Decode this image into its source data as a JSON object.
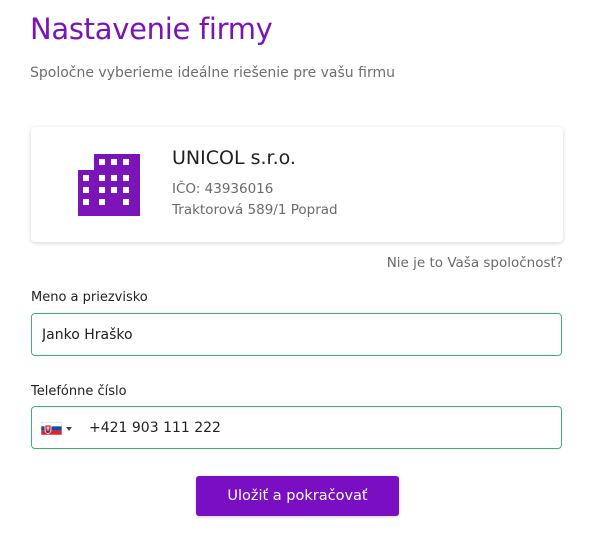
{
  "header": {
    "title": "Nastavenie firmy",
    "subtitle": "Spoločne vyberieme ideálne riešenie pre vašu firmu"
  },
  "company": {
    "icon": "building-icon",
    "name": "UNICOL s.r.o.",
    "ico": "IČO: 43936016",
    "address": "Traktorová 589/1 Poprad",
    "not_yours_link": "Nie je to Vaša spoločnosť?"
  },
  "form": {
    "name_label": "Meno a priezvisko",
    "name_value": "Janko Hraško",
    "phone_label": "Telefónne číslo",
    "phone_country": "SK",
    "phone_value": "+421 903 111 222",
    "submit_label": "Uložiť a pokračovať"
  },
  "colors": {
    "accent": "#7a14b8",
    "button": "#7a0ec2",
    "input_border": "#3bb56a"
  }
}
